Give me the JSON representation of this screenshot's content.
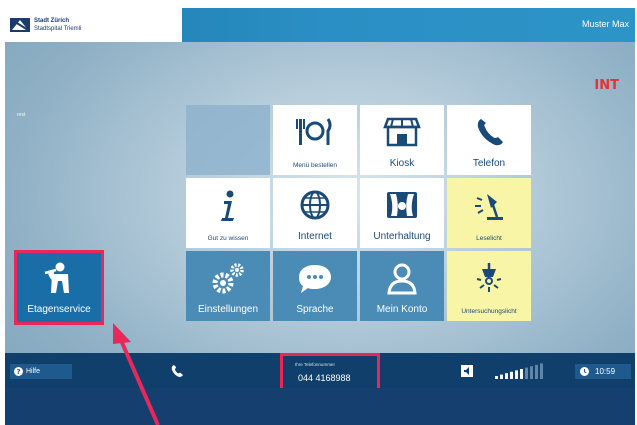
{
  "header": {
    "logo_line1": "Stadt Zürich",
    "logo_line2": "Stadtspital Triemli",
    "user_name": "Muster Max",
    "logo_icon": "city-logo-icon"
  },
  "indicator": "INT",
  "side_text": "rest",
  "tiles": {
    "menu": {
      "label": "Menü bestellen",
      "icon": "cutlery-icon"
    },
    "kiosk": {
      "label": "Kiosk",
      "icon": "shop-icon"
    },
    "telefon": {
      "label": "Telefon",
      "icon": "phone-icon"
    },
    "info": {
      "label": "Gut zu wissen",
      "icon": "info-icon"
    },
    "internet": {
      "label": "Internet",
      "icon": "globe-icon"
    },
    "unterhaltung": {
      "label": "Unterhaltung",
      "icon": "theater-icon"
    },
    "leselicht": {
      "label": "Leselicht",
      "icon": "reading-lamp-icon"
    },
    "einstellungen": {
      "label": "Einstellungen",
      "icon": "gears-icon"
    },
    "sprache": {
      "label": "Sprache",
      "icon": "speech-bubble-icon"
    },
    "konto": {
      "label": "Mein Konto",
      "icon": "user-icon"
    },
    "untersuchungslicht": {
      "label": "Untersuchungslicht",
      "icon": "exam-light-icon"
    },
    "etagenservice": {
      "label": "Etagenservice",
      "icon": "staff-icon"
    }
  },
  "bottom": {
    "help_label": "Hilfe",
    "phone_caption": "Ihre Telefonnummer",
    "phone_number": "044 4168988",
    "time": "10:59",
    "volume_level": 0.6
  },
  "colors": {
    "accent_highlight": "#e8285a",
    "bar_dark": "#0f3f6a",
    "tile_blue": "#4a8cb6",
    "tile_yellow": "#f8f5a6",
    "warning_red": "#e83030"
  }
}
